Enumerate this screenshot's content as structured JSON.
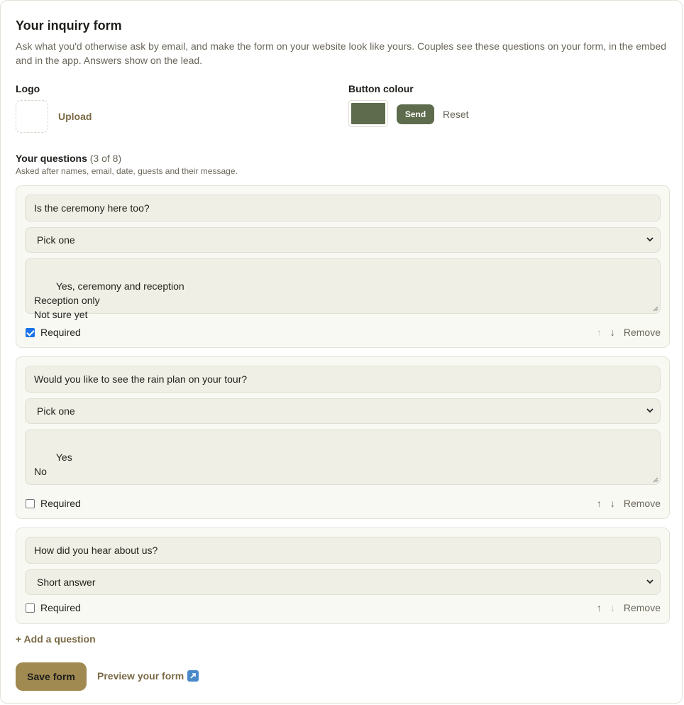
{
  "form": {
    "title": "Your inquiry form",
    "intro": "Ask what you'd otherwise ask by email, and make the form on your website look like yours. Couples see these questions on your form, in the embed and in the app. Answers show on the lead."
  },
  "branding": {
    "logo_label": "Logo",
    "upload_label": "Upload",
    "button_colour_label": "Button colour",
    "button_colour": "#5e6b4c",
    "send_preview_label": "Send",
    "reset_label": "Reset"
  },
  "questions_section": {
    "heading": "Your questions",
    "count": "(3 of 8)",
    "subtext": "Asked after names, email, date, guests and their message."
  },
  "questions": [
    {
      "text": "Is the ceremony here too?",
      "type": "Pick one",
      "options": "Yes, ceremony and reception\nReception only\nNot sure yet",
      "required": true,
      "required_label": "Required",
      "up": "↑",
      "down": "↓",
      "remove": "Remove"
    },
    {
      "text": "Would you like to see the rain plan on your tour?",
      "type": "Pick one",
      "options": "Yes\nNo",
      "required": false,
      "required_label": "Required",
      "up": "↑",
      "down": "↓",
      "remove": "Remove"
    },
    {
      "text": "How did you hear about us?",
      "type": "Short answer",
      "required": false,
      "required_label": "Required",
      "up": "↑",
      "down": "↓",
      "remove": "Remove"
    }
  ],
  "actions": {
    "add_question": "+ Add a question",
    "save": "Save form",
    "preview": "Preview your form",
    "preview_icon": "external-link-icon"
  }
}
